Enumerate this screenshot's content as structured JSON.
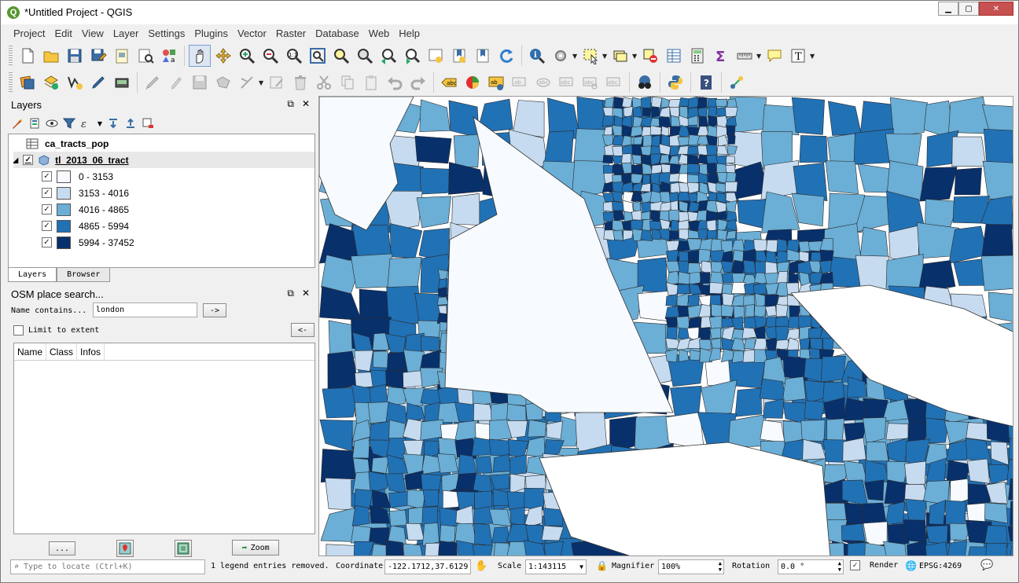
{
  "window": {
    "title": "*Untitled Project - QGIS",
    "app_icon": "Q"
  },
  "menus": [
    "Project",
    "Edit",
    "View",
    "Layer",
    "Settings",
    "Plugins",
    "Vector",
    "Raster",
    "Database",
    "Web",
    "Help"
  ],
  "layers_panel": {
    "title": "Layers",
    "layers": [
      {
        "name": "ca_tracts_pop"
      },
      {
        "name": "tl_2013_06_tract",
        "checked": true,
        "legend": [
          {
            "label": "0 - 3153",
            "color": "#f7fbff",
            "checked": true
          },
          {
            "label": "3153 - 4016",
            "color": "#c6dbef",
            "checked": true
          },
          {
            "label": "4016 - 4865",
            "color": "#6baed6",
            "checked": true
          },
          {
            "label": "4865 - 5994",
            "color": "#2171b5",
            "checked": true
          },
          {
            "label": "5994 - 37452",
            "color": "#08306b",
            "checked": true
          }
        ]
      }
    ],
    "tabs": [
      "Layers",
      "Browser"
    ]
  },
  "osm_panel": {
    "title": "OSM place search...",
    "name_label": "Name contains...",
    "name_value": "london",
    "go_button": "->",
    "limit_label": "Limit to extent",
    "back_button": "<-",
    "columns": [
      "Name",
      "Class",
      "Infos"
    ],
    "more_button": "...",
    "zoom_button": "Zoom"
  },
  "status": {
    "locator_placeholder": "Type to locate (Ctrl+K)",
    "message": "1 legend entries removed.",
    "coordinate_label": "Coordinate",
    "coordinate_value": "-122.1712,37.6129",
    "scale_label": "Scale",
    "scale_value": "1:143115",
    "magnifier_label": "Magnifier",
    "magnifier_value": "100%",
    "rotation_label": "Rotation",
    "rotation_value": "0.0 °",
    "render_label": "Render",
    "crs": "EPSG:4269"
  },
  "map_colors": [
    "#f7fbff",
    "#c6dbef",
    "#6baed6",
    "#2171b5",
    "#08306b"
  ]
}
